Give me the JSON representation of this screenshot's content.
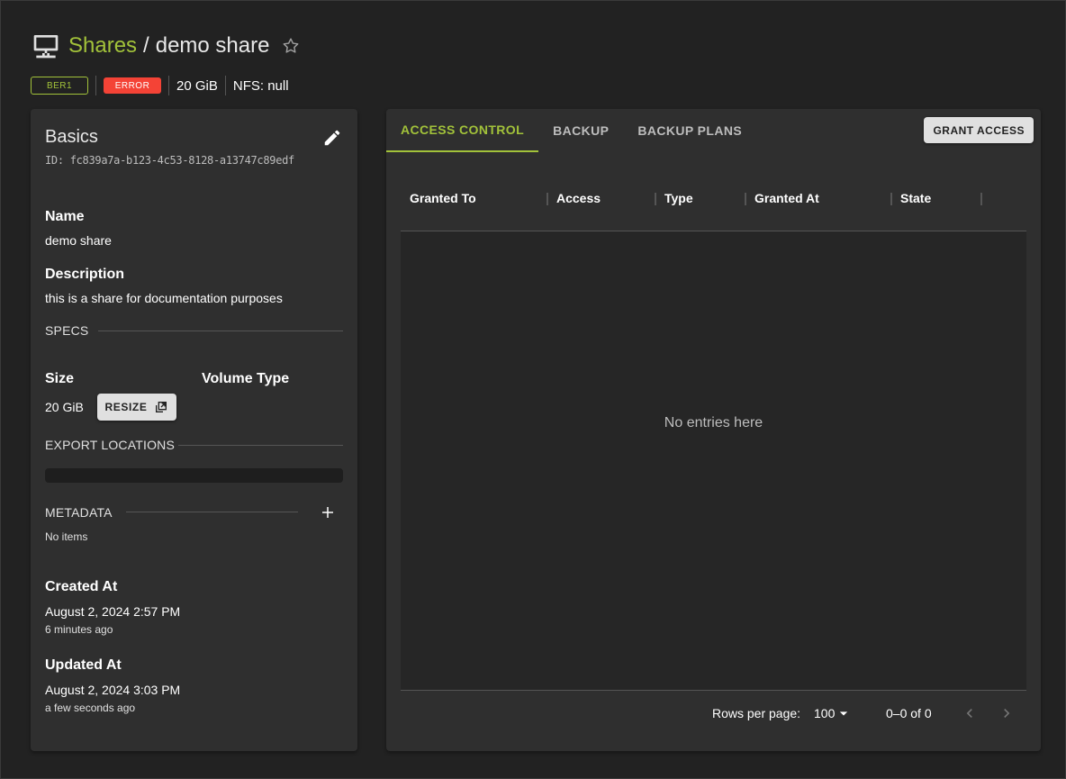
{
  "header": {
    "breadcrumb_root": "Shares",
    "separator": "/",
    "title": "demo share"
  },
  "chips": {
    "region": "BER1",
    "status": "ERROR",
    "size": "20 GiB",
    "protocol": "NFS: null"
  },
  "basics": {
    "title": "Basics",
    "id": "ID: fc839a7a-b123-4c53-8128-a13747c89edf",
    "name_label": "Name",
    "name_value": "demo share",
    "description_label": "Description",
    "description_value": "this is a share for documentation purposes",
    "specs_label": "SPECS",
    "size_label": "Size",
    "size_value": "20 GiB",
    "resize_label": "RESIZE",
    "volume_type_label": "Volume Type",
    "export_locations_label": "EXPORT LOCATIONS",
    "metadata_label": "METADATA",
    "metadata_empty": "No items",
    "created_label": "Created At",
    "created_value": "August 2, 2024 2:57 PM",
    "created_relative": "6 minutes ago",
    "updated_label": "Updated At",
    "updated_value": "August 2, 2024 3:03 PM",
    "updated_relative": "a few seconds ago"
  },
  "tabs": [
    {
      "label": "ACCESS CONTROL",
      "active": true
    },
    {
      "label": "BACKUP",
      "active": false
    },
    {
      "label": "BACKUP PLANS",
      "active": false
    }
  ],
  "grant_access_label": "GRANT ACCESS",
  "table": {
    "columns": [
      "Granted To",
      "Access",
      "Type",
      "Granted At",
      "State"
    ],
    "empty_text": "No entries here"
  },
  "pagination": {
    "rows_per_page_label": "Rows per page:",
    "rows_per_page_value": "100",
    "range": "0–0 of 0"
  },
  "colors": {
    "accent": "#a2c23a",
    "error": "#f44336",
    "background": "#222222",
    "card": "#2f2f2f"
  }
}
